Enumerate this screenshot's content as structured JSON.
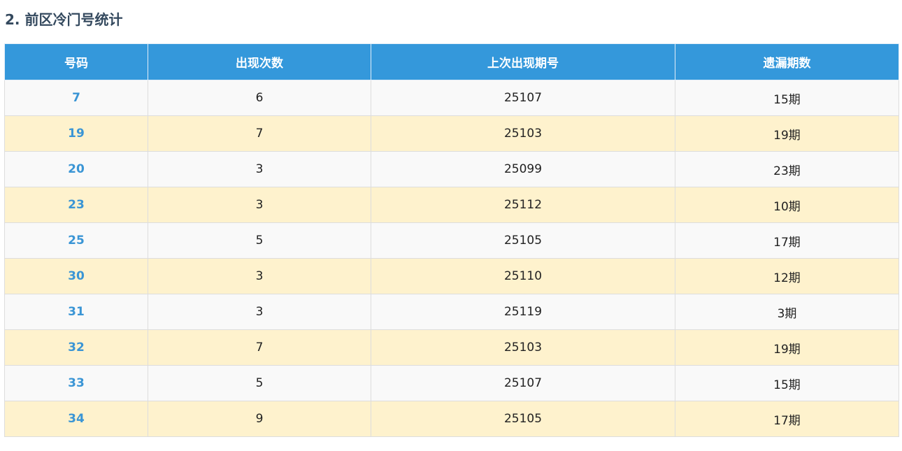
{
  "section": {
    "title": "2. 前区冷门号统计"
  },
  "table": {
    "headers": [
      "号码",
      "出现次数",
      "上次出现期号",
      "遗漏期数"
    ],
    "rows": [
      [
        "7",
        "6",
        "25107",
        "15期"
      ],
      [
        "19",
        "7",
        "25103",
        "19期"
      ],
      [
        "20",
        "3",
        "25099",
        "23期"
      ],
      [
        "23",
        "3",
        "25112",
        "10期"
      ],
      [
        "25",
        "5",
        "25105",
        "17期"
      ],
      [
        "30",
        "3",
        "25110",
        "12期"
      ],
      [
        "31",
        "3",
        "25119",
        "3期"
      ],
      [
        "32",
        "7",
        "25103",
        "19期"
      ],
      [
        "33",
        "5",
        "25107",
        "15期"
      ],
      [
        "34",
        "9",
        "25105",
        "17期"
      ]
    ]
  },
  "colors": {
    "header_bg": "#3498db",
    "number_text": "#3a95d5",
    "row_odd_bg": "#f9f9f9",
    "row_even_bg": "#fef2cd",
    "title_text": "#34495e"
  }
}
